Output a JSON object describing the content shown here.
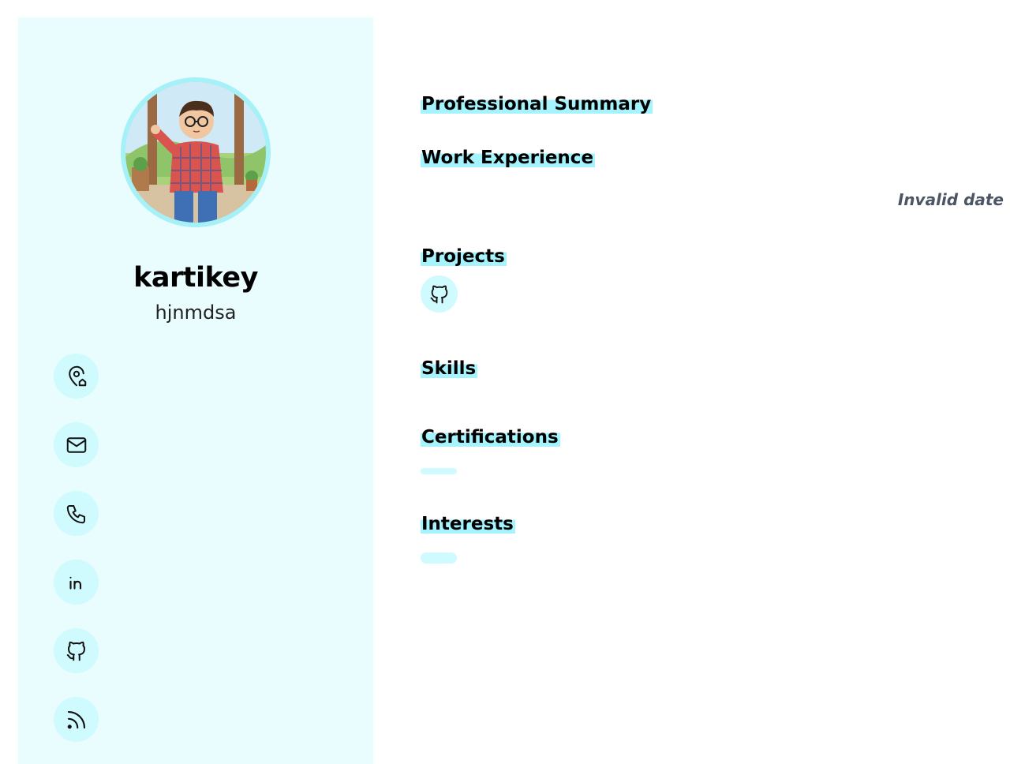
{
  "profile": {
    "name": "kartikey",
    "subtitle": "hjnmdsa"
  },
  "contacts": [
    {
      "icon": "location-pin-home-icon"
    },
    {
      "icon": "mail-icon"
    },
    {
      "icon": "phone-icon"
    },
    {
      "icon": "linkedin-icon"
    },
    {
      "icon": "github-icon"
    },
    {
      "icon": "rss-icon"
    }
  ],
  "sections": {
    "summary": "Professional Summary",
    "experience": "Work Experience",
    "experience_date": "Invalid date",
    "projects": "Projects",
    "skills": "Skills",
    "certifications": "Certifications",
    "interests": "Interests"
  },
  "colors": {
    "sidebar_bg": "#e9fcfe",
    "accent": "#a5f3fc",
    "icon_bg": "#cffafe"
  }
}
